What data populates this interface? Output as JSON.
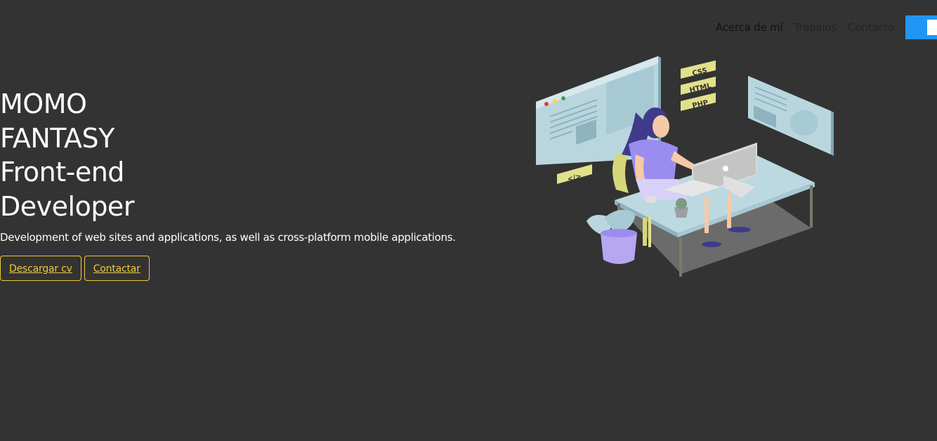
{
  "nav": {
    "items": [
      {
        "label": "Acerca de mí",
        "active": true
      },
      {
        "label": "Trabajos",
        "active": false
      },
      {
        "label": "Contacto",
        "active": false
      }
    ],
    "toggle_color": "#2196f3"
  },
  "hero": {
    "title_lines": [
      "MOMO",
      "FANTASY",
      "Front-end",
      "Developer"
    ],
    "description": "Development of web sites and applications, as well as cross-platform mobile applications.",
    "buttons": {
      "download": "Descargar cv",
      "contact": "Contactar"
    },
    "accent_color": "#f0c93a"
  },
  "illustration": {
    "tags": [
      "CSS",
      "HTML",
      "PHP"
    ],
    "code_tag": "</>"
  }
}
